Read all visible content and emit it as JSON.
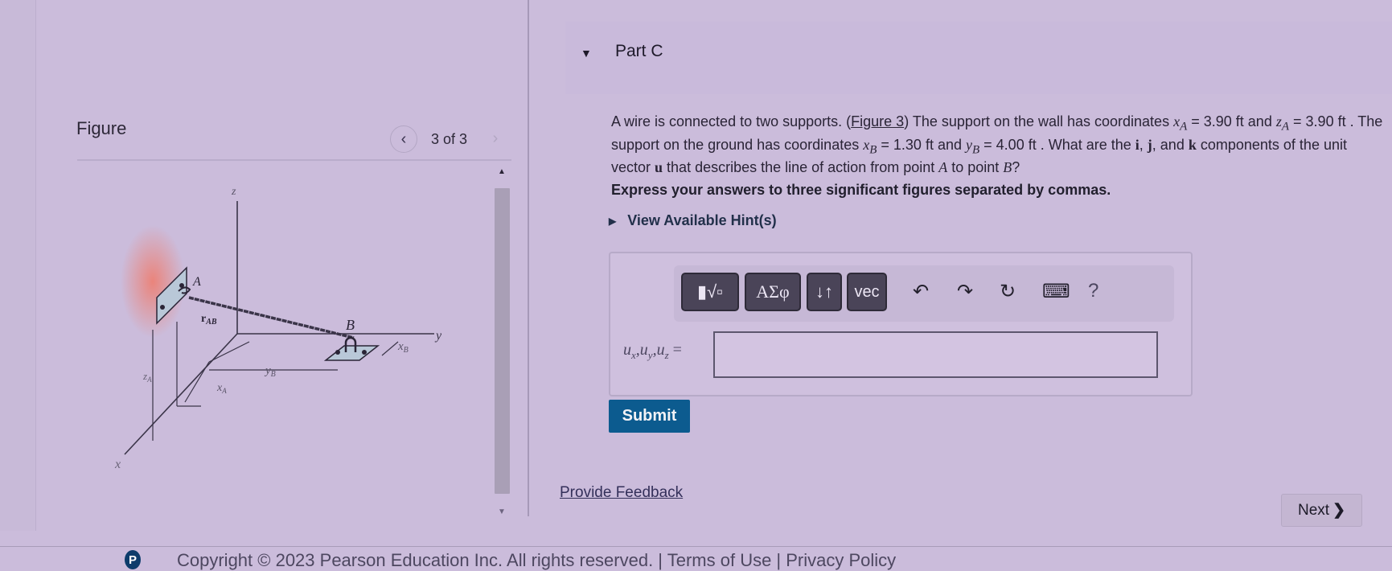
{
  "figure": {
    "title": "Figure",
    "counter": "3 of 3",
    "prev_icon": "chevron-left-icon",
    "next_icon": "chevron-right-icon",
    "labels": {
      "z_axis": "z",
      "x_axis": "x",
      "y_axis": "y",
      "point_a": "A",
      "point_b": "B",
      "r_ab": "r",
      "r_ab_sub": "AB",
      "z_a": "z",
      "z_a_sub": "A",
      "x_a": "x",
      "x_a_sub": "A",
      "y_b": "y",
      "y_b_sub": "B",
      "x_b": "x",
      "x_b_sub": "B"
    }
  },
  "part": {
    "title": "Part C",
    "question": {
      "t1": "A wire is connected to two supports. (",
      "figure_link": "Figure 3",
      "t2": ") The support on the wall has coordinates ",
      "xA_sym": "x",
      "xA_sub": "A",
      "xA_val": " = 3.90 ft and ",
      "zA_sym": "z",
      "zA_sub": "A",
      "zA_val": " = 3.90 ft . The support on the ground has coordinates ",
      "xB_sym": "x",
      "xB_sub": "B",
      "xB_val": " = 1.30 ft and ",
      "yB_sym": "y",
      "yB_sub": "B",
      "yB_val": " = 4.00 ft . What are the ",
      "i": "i",
      "comma1": ", ",
      "j": "j",
      "and": ", and ",
      "k": "k",
      "t3": " components of the unit vector ",
      "u": "u",
      "t4": " that describes the line of action from point ",
      "A": "A",
      "t5": " to point ",
      "B": "B",
      "t6": "?"
    },
    "instruction": "Express your answers to three significant figures separated by commas.",
    "hint_label": "View Available Hint(s)"
  },
  "toolbar": {
    "templates_label": "▮√▫",
    "greek_label": "ΑΣφ",
    "arrows_label": "↓↑",
    "vec_label": "vec",
    "undo": "↶",
    "redo": "↷",
    "reset": "↻",
    "keyboard": "⌨",
    "help": "?"
  },
  "answer": {
    "label": "uₓ,uᵧ,u_z =",
    "value": "",
    "placeholder": ""
  },
  "submit_label": "Submit",
  "feedback_label": "Provide Feedback",
  "next_label": "Next",
  "next_icon": "❯",
  "footer": {
    "logo": "P",
    "copyright": "Copyright © 2023  Pearson Education Inc. All rights reserved.  |  Terms of Use  |  Privacy Policy"
  }
}
